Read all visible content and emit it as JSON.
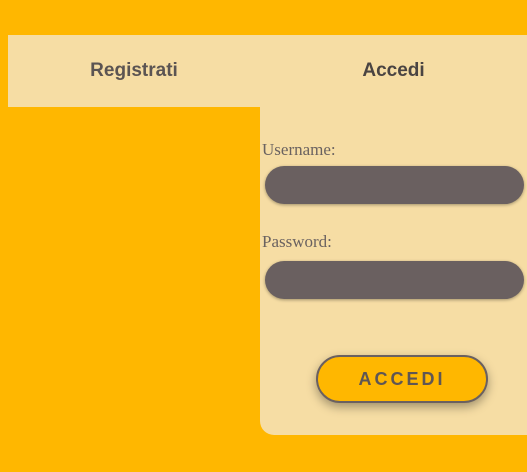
{
  "tabs": {
    "register_label": "Registrati",
    "login_label": "Accedi"
  },
  "form": {
    "username_label": "Username:",
    "username_value": "",
    "password_label": "Password:",
    "password_value": "",
    "submit_label": "ACCEDI"
  },
  "colors": {
    "background": "#FFB700",
    "panel": "#F6DDA4",
    "input": "#6A6060"
  }
}
